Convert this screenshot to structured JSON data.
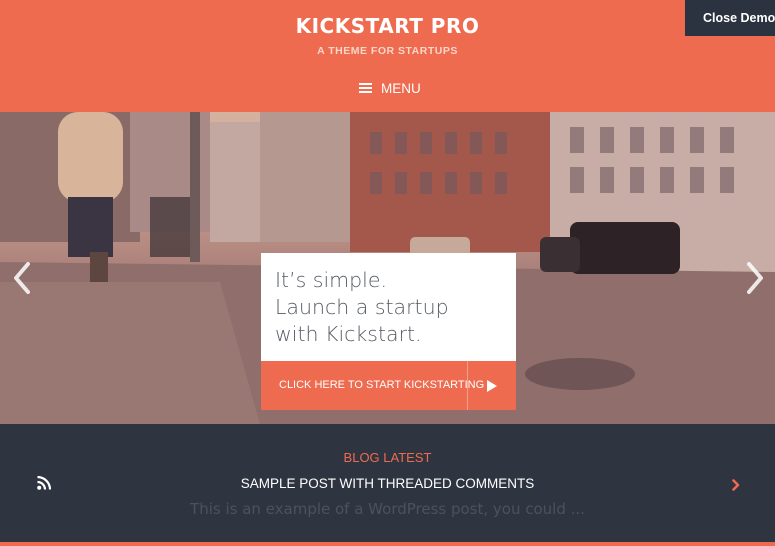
{
  "header": {
    "title": "KICKSTART PRO",
    "tagline": "A THEME FOR STARTUPS",
    "menu_label": "MENU",
    "close_demo": "Close Demo"
  },
  "hero": {
    "lines": [
      "It’s simple.",
      "Launch a startup",
      "with Kickstart."
    ],
    "cta_label": "CLICK HERE TO START KICKSTARTING"
  },
  "blog": {
    "heading": "BLOG LATEST",
    "post_title": "SAMPLE POST WITH THREADED COMMENTS",
    "excerpt": "This is an example of a WordPress post, you could ..."
  },
  "colors": {
    "accent": "#ee6b4f",
    "dark": "#2f3540"
  },
  "icons": {
    "menu": "hamburger-icon",
    "prev": "chevron-left-icon",
    "next": "chevron-right-icon",
    "play": "play-icon",
    "rss": "rss-icon",
    "post_next": "chevron-right-icon"
  }
}
